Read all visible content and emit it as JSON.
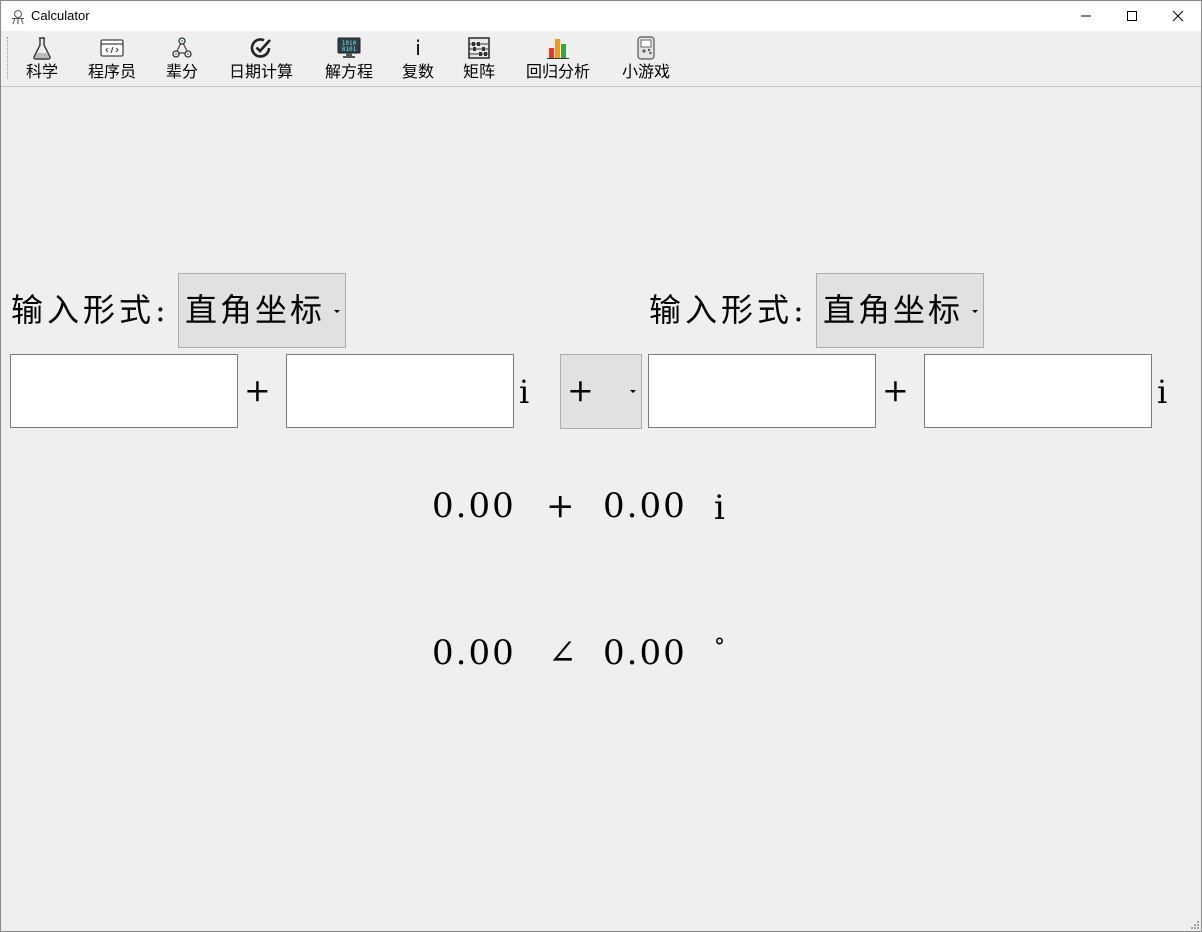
{
  "window": {
    "title": "Calculator"
  },
  "toolbar": {
    "items": [
      {
        "label": "科学",
        "icon": "flask-icon"
      },
      {
        "label": "程序员",
        "icon": "code-window-icon"
      },
      {
        "label": "辈分",
        "icon": "family-tree-icon"
      },
      {
        "label": "日期计算",
        "icon": "date-check-icon"
      },
      {
        "label": "解方程",
        "icon": "binary-monitor-icon"
      },
      {
        "label": "复数",
        "icon": "imaginary-i-icon",
        "glyph": "i"
      },
      {
        "label": "矩阵",
        "icon": "abacus-icon"
      },
      {
        "label": "回归分析",
        "icon": "bar-chart-icon"
      },
      {
        "label": "小游戏",
        "icon": "game-device-icon"
      }
    ]
  },
  "left": {
    "form_label": "输入形式:",
    "form_value": "直角坐标",
    "real_value": "",
    "imag_value": "",
    "plus": "+",
    "i": "i"
  },
  "operator": {
    "value": "+"
  },
  "right": {
    "form_label": "输入形式:",
    "form_value": "直角坐标",
    "real_value": "",
    "imag_value": "",
    "plus": "+",
    "i": "i"
  },
  "result": {
    "rect": {
      "real": "0.00",
      "op": "+",
      "imag": "0.00",
      "unit": "i"
    },
    "polar": {
      "modulus": "0.00",
      "angle_symbol": "∠",
      "angle": "0.00",
      "unit": "°"
    }
  }
}
